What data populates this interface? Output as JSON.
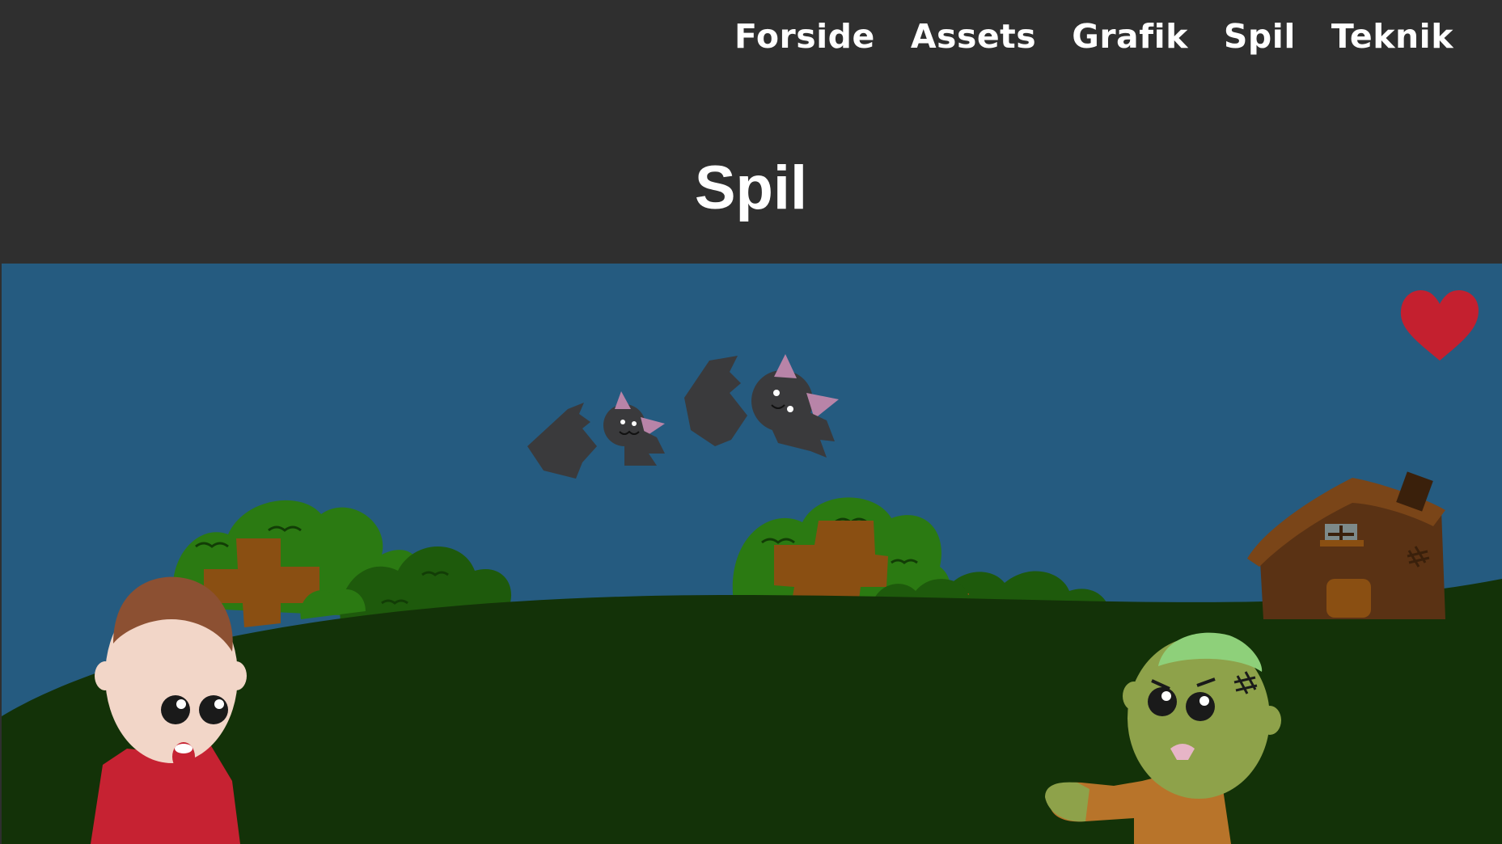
{
  "nav": {
    "items": [
      {
        "label": "Forside"
      },
      {
        "label": "Assets"
      },
      {
        "label": "Grafik"
      },
      {
        "label": "Spil"
      },
      {
        "label": "Teknik"
      }
    ]
  },
  "page": {
    "title": "Spil"
  },
  "game": {
    "lives": 1,
    "colors": {
      "sky": "#255b80",
      "ground": "#133208",
      "bush_light": "#2b7a12",
      "bush_dark": "#1e5a0c",
      "cross": "#8a4f12",
      "heart": "#c4202f",
      "bat": "#3a3a3c",
      "zombie_skin": "#8ea24a",
      "zombie_shirt": "#b8742a",
      "boy_shirt": "#c62232",
      "house": "#5a3214"
    }
  }
}
